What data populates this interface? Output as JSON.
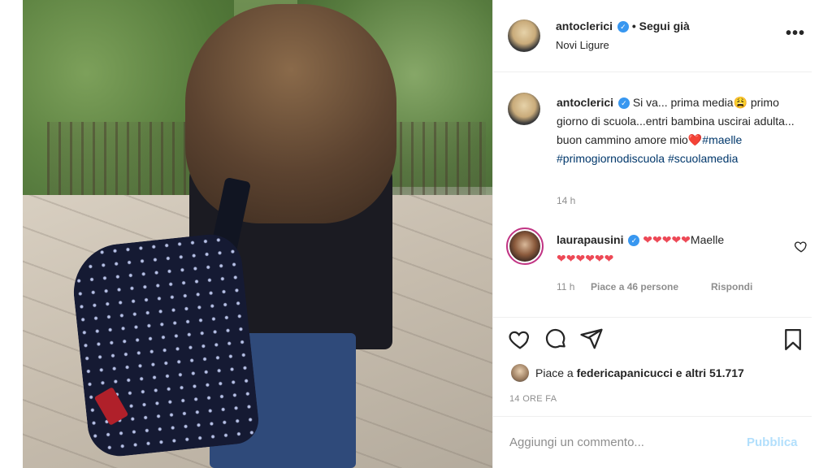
{
  "header": {
    "username": "antoclerici",
    "follow_label": "Segui già",
    "separator": "•",
    "location": "Novi Ligure",
    "more_label": "•••"
  },
  "caption": {
    "username": "antoclerici",
    "text_1": "Si va... prima media",
    "emoji_1": "😩",
    "text_2": "primo giorno di scuola...entri bambina uscirai adulta... buon cammino amore mio",
    "heart": "❤️",
    "hashtag_1": "#maelle",
    "hashtag_2": "#primogiornodiscuola",
    "hashtag_3": "#scuolamedia",
    "time": "14 h"
  },
  "comment": {
    "username": "laurapausini",
    "hearts_line_1": "❤❤❤❤❤",
    "text": "Maelle",
    "hearts_line_2": "❤❤❤❤❤❤",
    "time": "11 h",
    "likes": "Piace a 46 persone",
    "reply": "Rispondi"
  },
  "likes": {
    "prefix": "Piace a",
    "user": "federicapanicucci",
    "suffix": "e altri 51.717"
  },
  "time_ago": "14 ORE FA",
  "add_comment": {
    "placeholder": "Aggiungi un commento...",
    "publish_label": "Pubblica"
  },
  "colors": {
    "link": "#00376b",
    "verified": "#3897f0",
    "heart": "#ed4956",
    "publish_disabled": "#b2dffc"
  }
}
